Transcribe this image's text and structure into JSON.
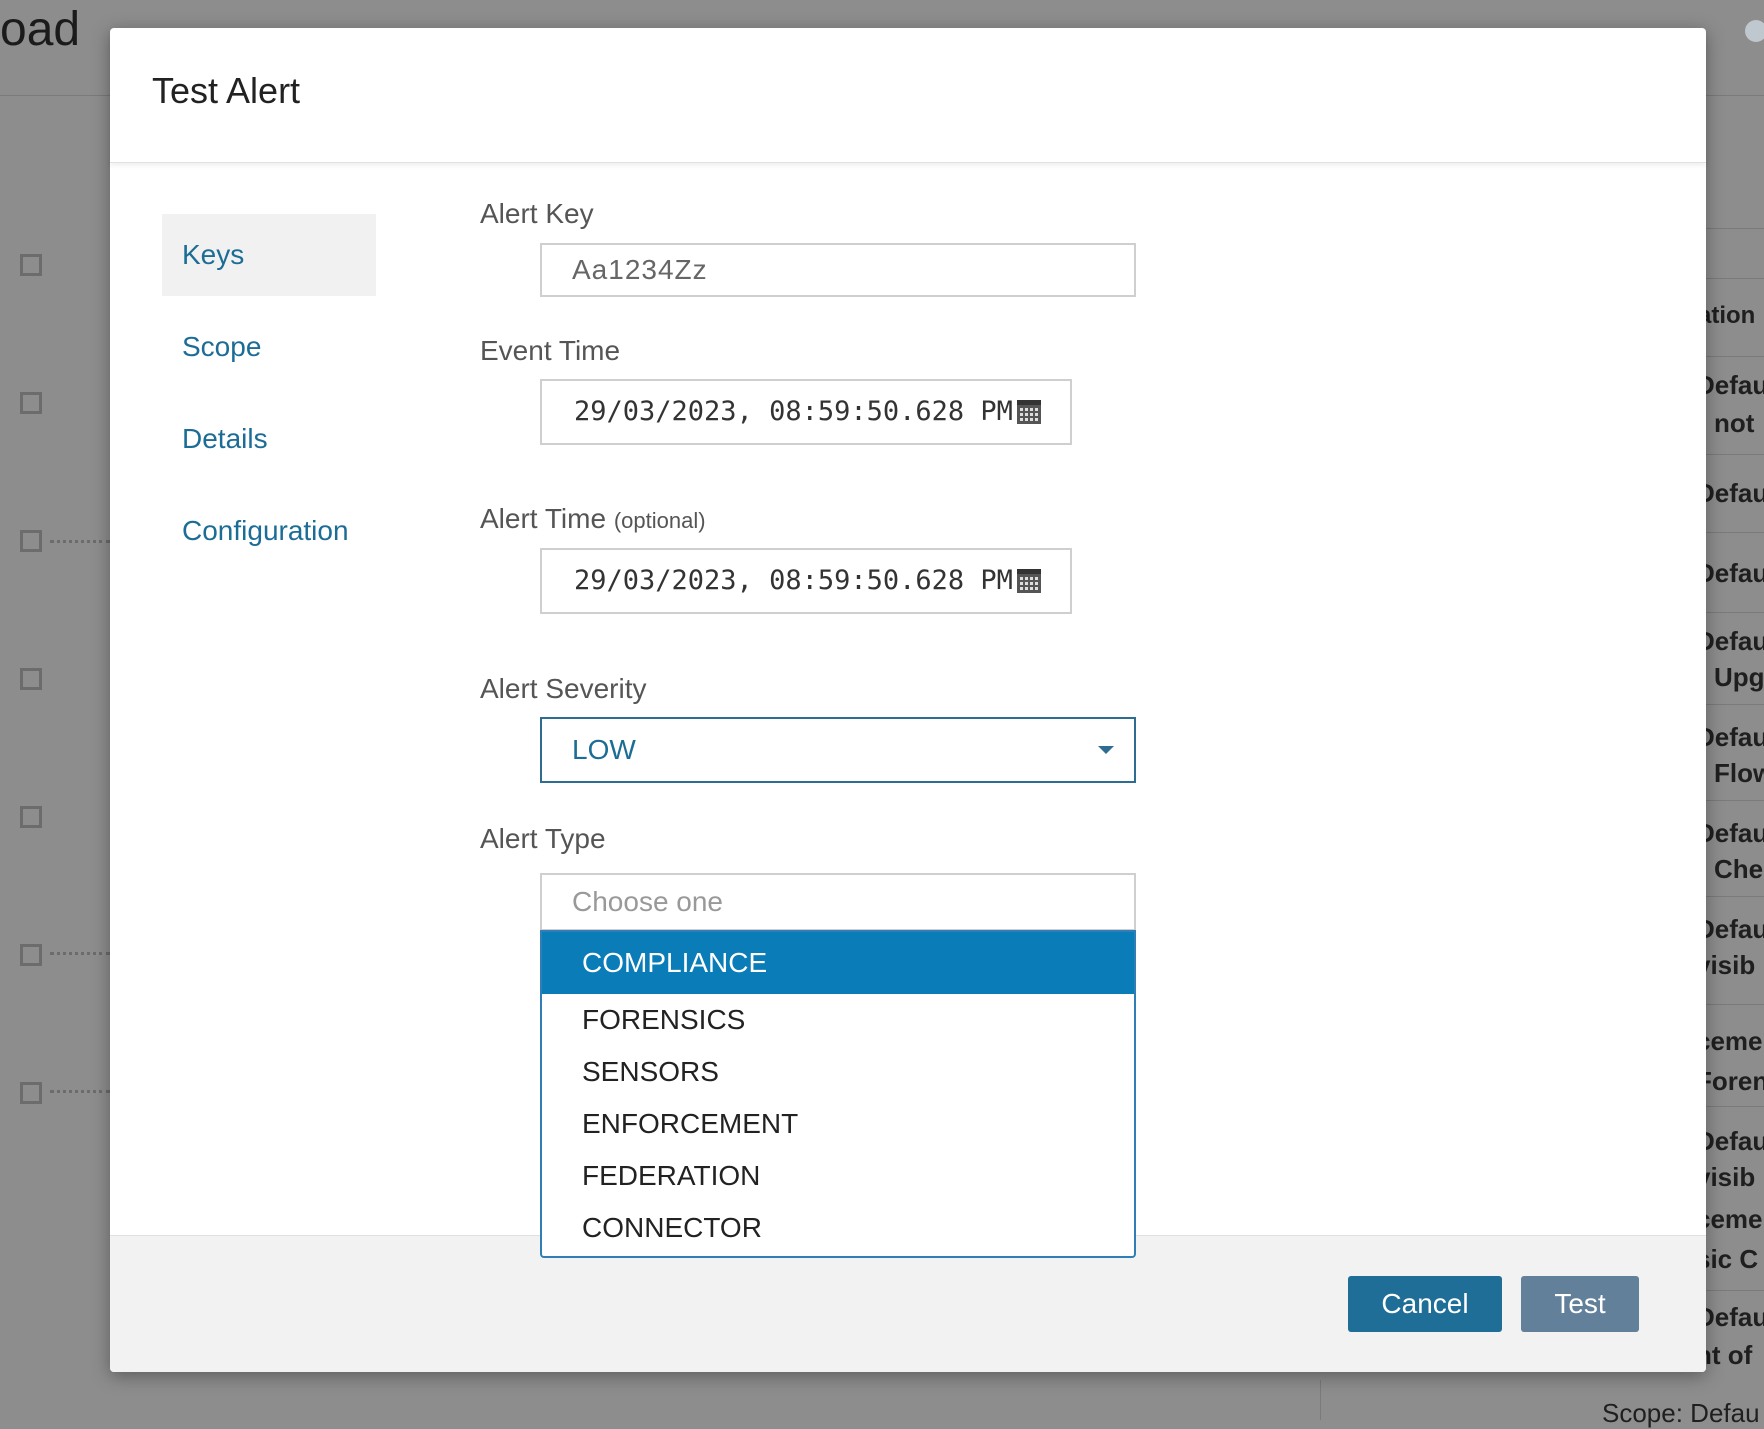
{
  "background": {
    "title_fragment": "oad",
    "right_column_fragments": [
      "ation",
      "Defau",
      "not",
      "Defau",
      "Defau",
      "Defau",
      "Upg",
      "Defau",
      "Flow",
      "Defau",
      "Che",
      "Defau",
      "visib",
      "ceme",
      "Foren",
      "Defau",
      "visib",
      "ceme",
      "sic C",
      "Defau",
      "nt of"
    ],
    "scope_fragment": "Scope: Defau"
  },
  "modal": {
    "title": "Test Alert",
    "nav": [
      "Keys",
      "Scope",
      "Details",
      "Configuration"
    ],
    "fields": {
      "alert_key": {
        "label": "Alert Key",
        "placeholder": "Aa1234Zz"
      },
      "event_time": {
        "label": "Event Time",
        "value": "29/03/2023, 08:59:50.628 PM"
      },
      "alert_time": {
        "label": "Alert Time",
        "optional": "(optional)",
        "value": "29/03/2023, 08:59:50.628 PM"
      },
      "alert_severity": {
        "label": "Alert Severity",
        "value": "LOW"
      },
      "alert_type": {
        "label": "Alert Type",
        "placeholder": "Choose one",
        "options": [
          "COMPLIANCE",
          "FORENSICS",
          "SENSORS",
          "ENFORCEMENT",
          "FEDERATION",
          "CONNECTOR"
        ],
        "highlighted": "COMPLIANCE"
      }
    },
    "buttons": {
      "cancel": "Cancel",
      "test": "Test"
    }
  },
  "colors": {
    "accent": "#1c6d96",
    "dropdown_highlight": "#0a7cb8",
    "cancel_button": "#1f6e98",
    "test_button": "#63809a"
  }
}
